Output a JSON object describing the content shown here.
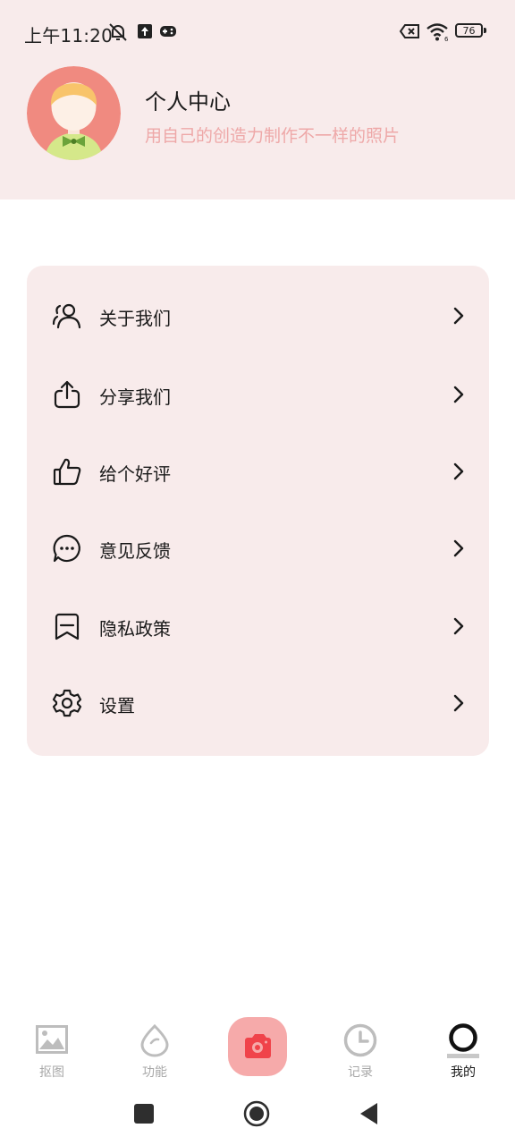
{
  "status_bar": {
    "time": "上午11:20",
    "battery": "76",
    "icons": [
      "bell-muted-icon",
      "upload-icon",
      "gamepad-icon",
      "sim-off-icon",
      "wifi-icon",
      "battery-icon"
    ]
  },
  "profile": {
    "title": "个人中心",
    "subtitle": "用自己的创造力制作不一样的照片",
    "avatar_icon": "avatar-boy-icon"
  },
  "menu": {
    "items": [
      {
        "label": "关于我们",
        "icon": "users-icon"
      },
      {
        "label": "分享我们",
        "icon": "share-icon"
      },
      {
        "label": "给个好评",
        "icon": "thumbs-up-icon"
      },
      {
        "label": "意见反馈",
        "icon": "chat-bubble-icon"
      },
      {
        "label": "隐私政策",
        "icon": "bookmark-icon"
      },
      {
        "label": "设置",
        "icon": "gear-icon"
      }
    ]
  },
  "tabbar": {
    "tabs": [
      {
        "label": "抠图",
        "icon": "image-icon",
        "active": false
      },
      {
        "label": "功能",
        "icon": "drop-icon",
        "active": false
      },
      {
        "label": "",
        "icon": "camera-icon",
        "active": false
      },
      {
        "label": "记录",
        "icon": "clock-icon",
        "active": false
      },
      {
        "label": "我的",
        "icon": "profile-ring-icon",
        "active": true
      }
    ]
  },
  "colors": {
    "header_bg": "#f8ebeb",
    "accent": "#f6aaaa",
    "subtitle": "#eea8a8",
    "inactive": "#a8a8a8"
  }
}
